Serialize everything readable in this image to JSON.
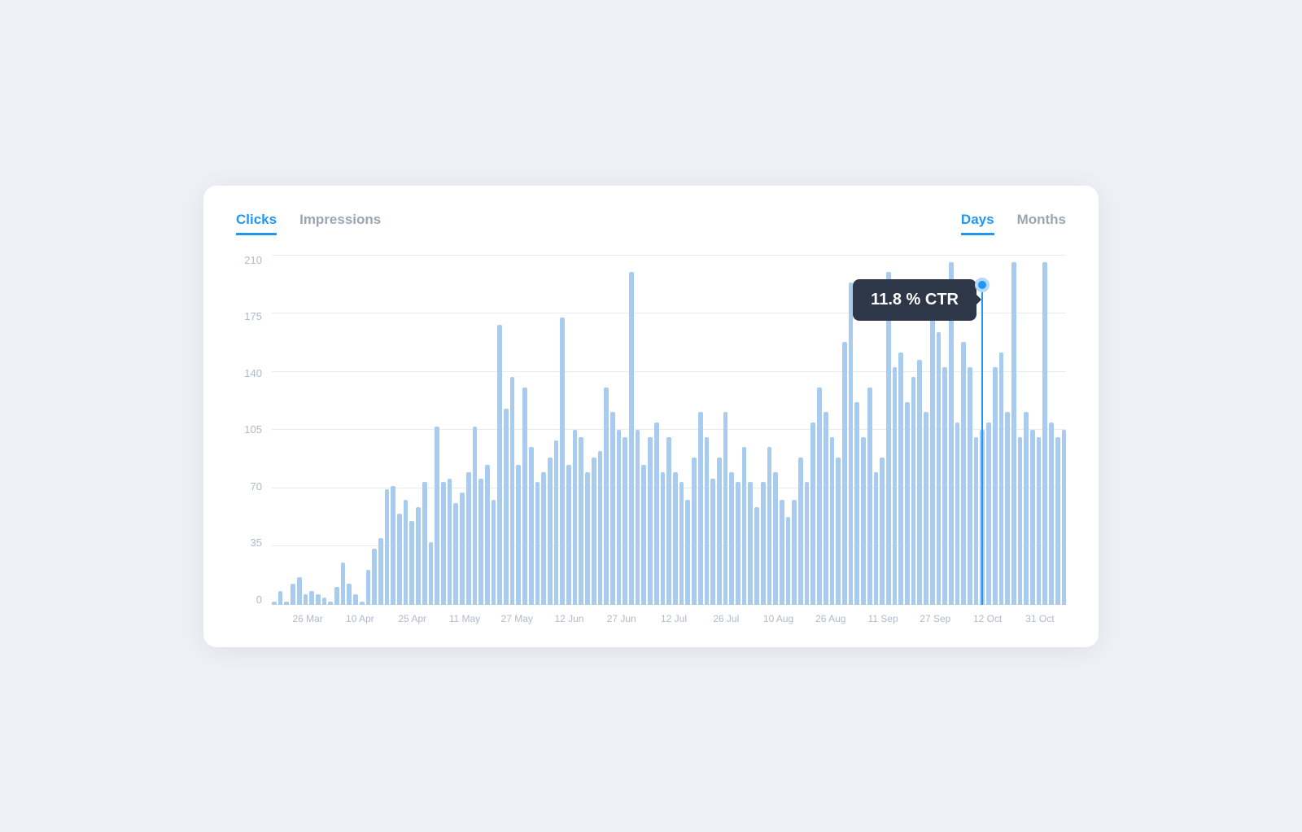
{
  "header": {
    "tabs_left": [
      {
        "label": "Clicks",
        "active": true
      },
      {
        "label": "Impressions",
        "active": false
      }
    ],
    "tabs_right": [
      {
        "label": "Days",
        "active": true
      },
      {
        "label": "Months",
        "active": false
      }
    ]
  },
  "chart": {
    "y_labels": [
      "210",
      "175",
      "140",
      "105",
      "70",
      "35",
      "0"
    ],
    "x_labels": [
      "26 Mar",
      "10 Apr",
      "25 Apr",
      "11 May",
      "27 May",
      "12 Jun",
      "27 Jun",
      "12 Jul",
      "26 Jul",
      "10 Aug",
      "26 Aug",
      "11 Sep",
      "27 Sep",
      "12 Oct",
      "31 Oct"
    ],
    "tooltip_text": "11.8 % CTR",
    "bar_heights_percent": [
      1,
      4,
      1,
      6,
      8,
      3,
      4,
      3,
      2,
      1,
      5,
      12,
      6,
      3,
      1,
      10,
      16,
      19,
      33,
      34,
      26,
      30,
      24,
      28,
      35,
      18,
      51,
      35,
      36,
      29,
      32,
      38,
      51,
      36,
      40,
      30,
      80,
      56,
      65,
      40,
      62,
      45,
      35,
      38,
      42,
      47,
      82,
      40,
      50,
      48,
      38,
      42,
      44,
      62,
      55,
      50,
      48,
      95,
      50,
      40,
      48,
      52,
      38,
      48,
      38,
      35,
      30,
      42,
      55,
      48,
      36,
      42,
      55,
      38,
      35,
      45,
      35,
      28,
      35,
      45,
      38,
      30,
      25,
      30,
      42,
      35,
      52,
      62,
      55,
      48,
      42,
      75,
      92,
      58,
      48,
      62,
      38,
      42,
      95,
      68,
      72,
      58,
      65,
      70,
      55,
      82,
      78,
      68,
      98,
      52,
      75,
      68,
      48,
      50,
      52,
      68,
      72,
      55,
      98,
      48,
      55,
      50,
      48,
      98,
      52,
      48,
      50
    ]
  }
}
